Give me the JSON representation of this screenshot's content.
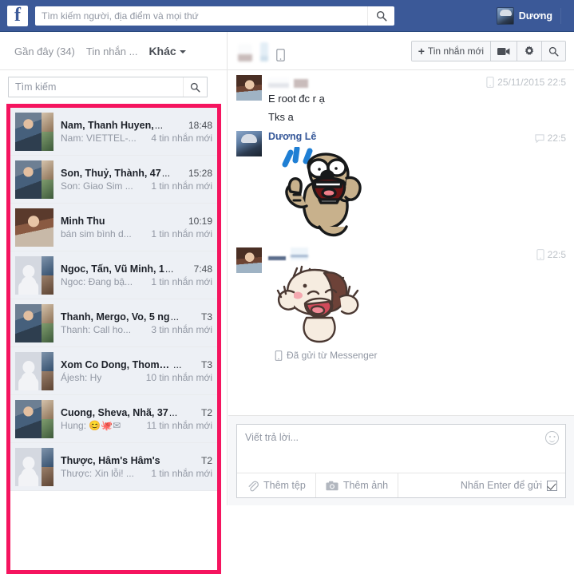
{
  "topbar": {
    "logo": "f",
    "search_placeholder": "Tìm kiếm người, địa điểm và mọi thứ",
    "search_value": "",
    "search_icon": "search-icon",
    "profile_name": "Dương"
  },
  "subbar": {
    "tabs": [
      {
        "label": "Gần đây (34)",
        "active": false
      },
      {
        "label": "Tin nhắn ...",
        "active": false
      },
      {
        "label": "Khác",
        "active": true,
        "has_caret": true
      }
    ],
    "actions": {
      "new_message_label": "Tin nhắn mới",
      "new_message_plus": "+",
      "video_icon": "video-camera-icon",
      "settings_icon": "gear-icon",
      "search_icon": "search-icon"
    }
  },
  "left_panel": {
    "search_placeholder": "Tìm kiếm",
    "search_value": "",
    "conversations": [
      {
        "name": "Nam, Thanh Huyen,",
        "name_overflow": "...",
        "time": "18:48",
        "snippet": "Nam: VIETTEL-...",
        "badge": "4 tin nhắn mới",
        "avatar": "group-photo"
      },
      {
        "name": "Son, Thuỷ, Thành, 47",
        "name_overflow": "...",
        "time": "15:28",
        "snippet": "Son: Giao Sim ...",
        "badge": "1 tin nhắn mới",
        "avatar": "group-photo"
      },
      {
        "name": "Minh Thu",
        "name_overflow": "",
        "time": "10:19",
        "snippet": "bán sim bình d...",
        "badge": "1 tin nhắn mới",
        "avatar": "single-photo"
      },
      {
        "name": "Ngoc, Tấn, Vũ Minh, 1",
        "name_overflow": "...",
        "time": "7:48",
        "snippet": "Ngoc: Đang bậ...",
        "badge": "1 tin nhắn mới",
        "avatar": "group-silhouette"
      },
      {
        "name": "Thanh, Mergo, Vo, 5 ng",
        "name_overflow": "...",
        "time": "T3",
        "snippet": "Thanh: Call ho...",
        "badge": "3 tin nhắn mới",
        "avatar": "group-photo"
      },
      {
        "name": "Xom Co Dong, Thomas,",
        "name_overflow": "...",
        "time": "T3",
        "snippet": "Ájesh: Hy",
        "badge": "10 tin nhắn mới",
        "avatar": "group-silhouette"
      },
      {
        "name": "Cuong, Sheva, Nhã, 37",
        "name_overflow": "...",
        "time": "T2",
        "snippet": "Hung: 😊🐙✉",
        "badge": "11 tin nhắn mới",
        "avatar": "group-photo"
      },
      {
        "name": "Thược, Hâm's Hâm's",
        "name_overflow": "",
        "time": "T2",
        "snippet": "Thược: Xin lỗi! ...",
        "badge": "1 tin nhắn mới",
        "avatar": "group-silhouette"
      }
    ]
  },
  "thread": {
    "header_title_redacted": true,
    "messages": [
      {
        "sender_redacted": true,
        "sender_name": "",
        "timestamp": "25/11/2015 22:5",
        "timestamp_icon": "mobile-icon",
        "texts": [
          "E root đc r ạ",
          "Tks a"
        ],
        "sticker": "none",
        "avatar": "girl-photo"
      },
      {
        "sender_redacted": false,
        "sender_name": "Dương Lê",
        "timestamp": "22:5",
        "timestamp_icon": "comment-icon",
        "texts": [],
        "sticker": "dog-thumbs-up",
        "avatar": "dreamer-photo"
      },
      {
        "sender_redacted": true,
        "sender_name": "",
        "timestamp": "22:5",
        "timestamp_icon": "mobile-icon",
        "texts": [],
        "sticker": "happy-puppy",
        "avatar": "girl-photo"
      }
    ],
    "sent_via_label": "Đã gửi từ Messenger",
    "sent_via_icon": "mobile-icon"
  },
  "composer": {
    "placeholder": "Viết trả lời...",
    "value": "",
    "emoji_icon": "smiley-icon",
    "attach_file_label": "Thêm tệp",
    "attach_file_icon": "paperclip-icon",
    "attach_photo_label": "Thêm ảnh",
    "attach_photo_icon": "camera-icon",
    "enter_to_send_label": "Nhấn Enter để gửi",
    "enter_to_send_checked": true
  },
  "colors": {
    "fb_blue": "#3b5998",
    "highlight_pink": "#f5145f",
    "list_bg": "#edf0f5",
    "text_dark": "#1d2129",
    "text_muted": "#9197a3",
    "link_blue": "#365899"
  }
}
